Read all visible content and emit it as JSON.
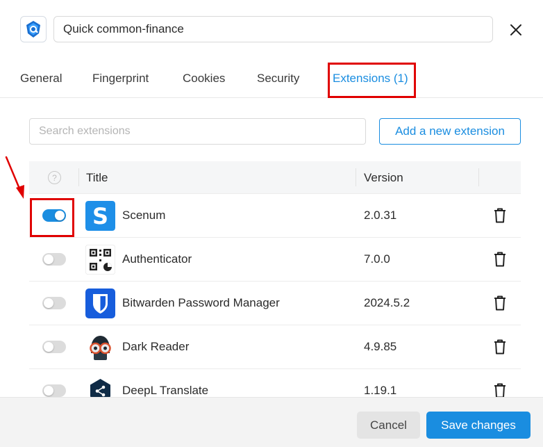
{
  "header": {
    "profile_name": "Quick common-finance",
    "close_icon": "close-icon",
    "logo_icon": "app-logo-icon"
  },
  "tabs": [
    {
      "label": "General",
      "active": false
    },
    {
      "label": "Fingerprint",
      "active": false
    },
    {
      "label": "Cookies",
      "active": false
    },
    {
      "label": "Security",
      "active": false
    },
    {
      "label": "Extensions (1)",
      "active": true
    }
  ],
  "toolbar": {
    "search_placeholder": "Search extensions",
    "search_value": "",
    "add_label": "Add a new extension"
  },
  "table": {
    "help_glyph": "?",
    "columns": {
      "title": "Title",
      "version": "Version"
    },
    "rows": [
      {
        "enabled": true,
        "name": "Scenum",
        "version": "2.0.31",
        "icon": "scenum-icon"
      },
      {
        "enabled": false,
        "name": "Authenticator",
        "version": "7.0.0",
        "icon": "authenticator-icon"
      },
      {
        "enabled": false,
        "name": "Bitwarden Password Manager",
        "version": "2024.5.2",
        "icon": "bitwarden-icon"
      },
      {
        "enabled": false,
        "name": "Dark Reader",
        "version": "4.9.85",
        "icon": "dark-reader-icon"
      },
      {
        "enabled": false,
        "name": "DeepL Translate",
        "version": "1.19.1",
        "icon": "deepl-icon"
      }
    ]
  },
  "footer": {
    "cancel_label": "Cancel",
    "save_label": "Save changes"
  },
  "colors": {
    "accent": "#1a8de0",
    "highlight": "#e00000"
  }
}
